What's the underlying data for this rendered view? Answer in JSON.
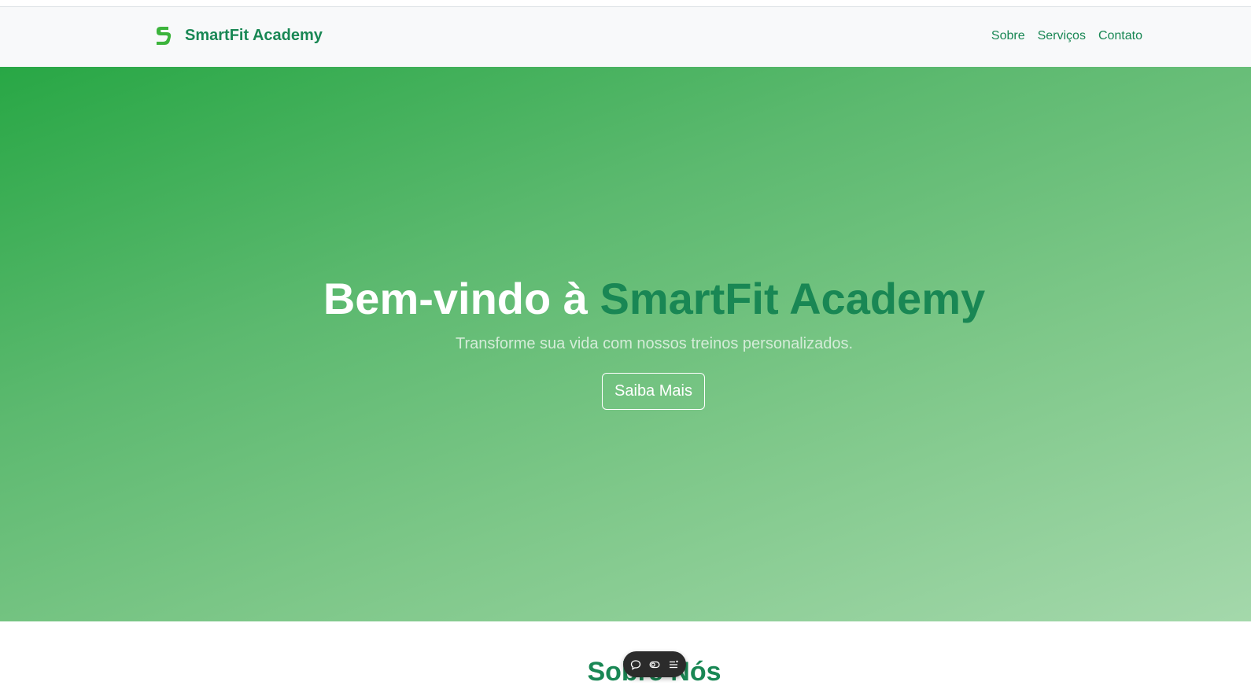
{
  "navbar": {
    "brand_name": "SmartFit Academy",
    "brand_logo_icon": "s-logo-icon",
    "links": [
      {
        "label": "Sobre"
      },
      {
        "label": "Serviços"
      },
      {
        "label": "Contato"
      }
    ]
  },
  "hero": {
    "title_prefix": "Bem-vindo à ",
    "title_accent": "SmartFit Academy",
    "subtitle": "Transforme sua vida com nossos treinos personalizados.",
    "button_label": "Saiba Mais"
  },
  "about": {
    "title": "Sobre Nós"
  },
  "floating_toolbar": {
    "icons": [
      "comment-icon",
      "toggle-icon",
      "list-icon"
    ]
  },
  "colors": {
    "brand_green": "#198754",
    "logo_green": "#3cb43c",
    "navbar_bg": "#f8f9fa",
    "hero_gradient_start": "#28a745",
    "hero_gradient_end": "#a4d8ab"
  }
}
